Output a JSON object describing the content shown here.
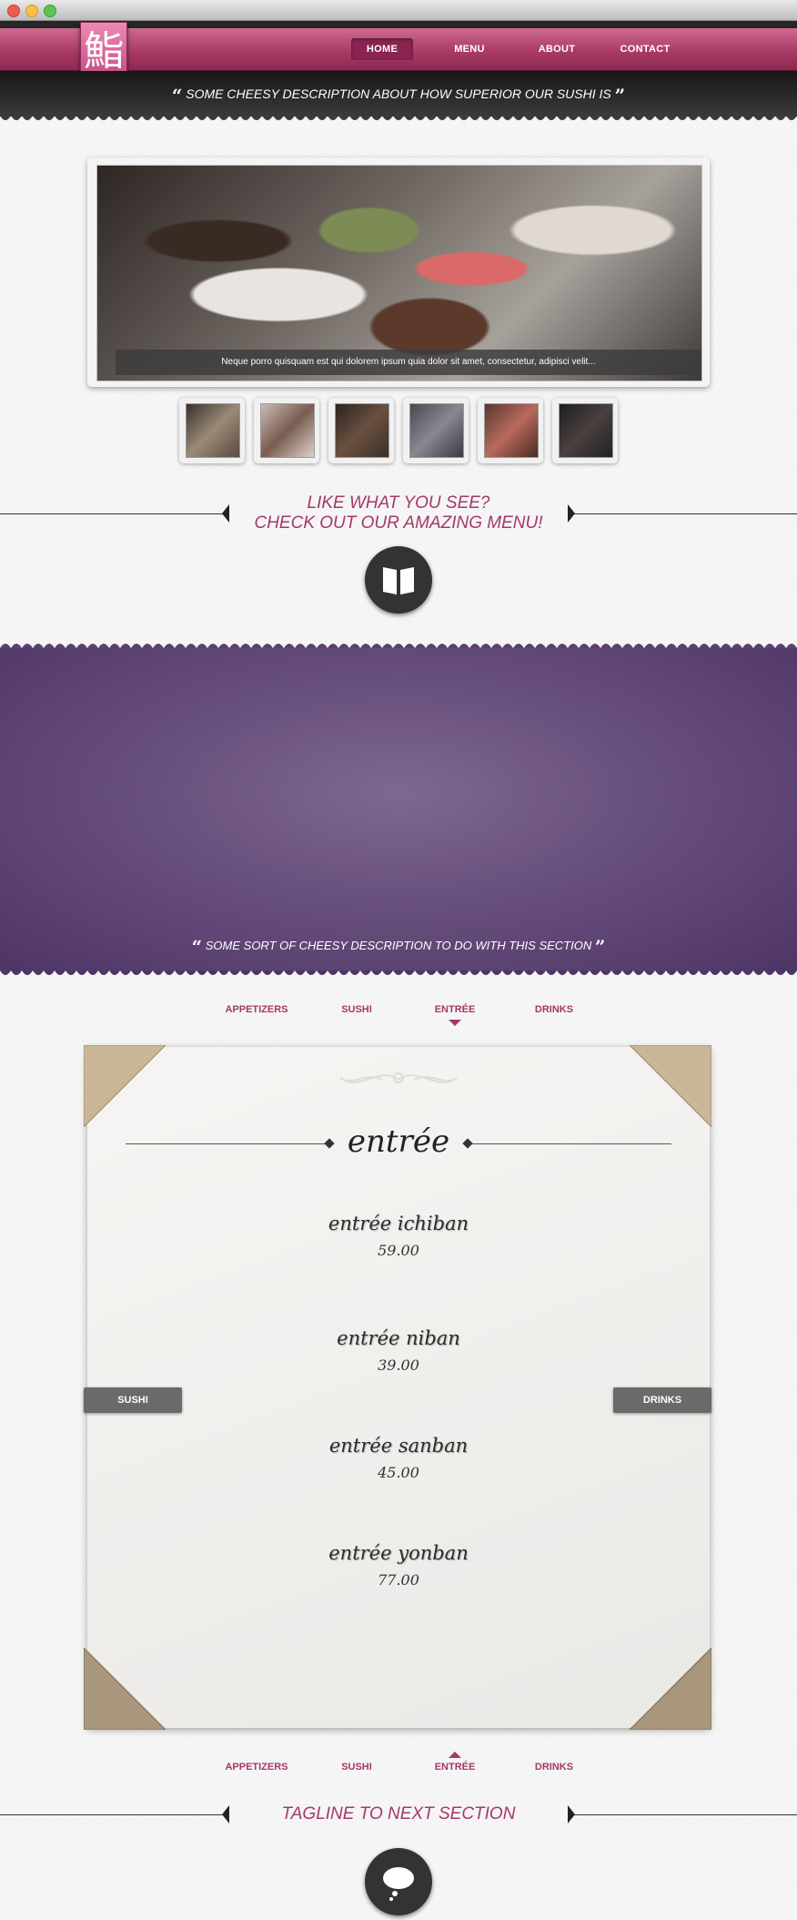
{
  "header": {
    "logo_glyph": "鮨",
    "nav": [
      "HOME",
      "MENU",
      "ABOUT",
      "CONTACT"
    ],
    "tagline": "SOME CHEESY DESCRIPTION ABOUT HOW SUPERIOR OUR SUSHI IS"
  },
  "slider": {
    "caption": "Neque porro quisquam est qui dolorem ipsum quia dolor sit amet, consectetur, adipisci velit..."
  },
  "cta": {
    "line1": "LIKE WHAT YOU SEE?",
    "line2": "CHECK OUT OUR AMAZING MENU!"
  },
  "section": {
    "description": "SOME SORT OF CHEESY DESCRIPTION TO DO WITH THIS SECTION"
  },
  "menu": {
    "tabs": [
      "APPETIZERS",
      "SUSHI",
      "ENTRÉE",
      "DRINKS"
    ],
    "active_tab": "ENTRÉE",
    "title": "entrée",
    "items": [
      {
        "name": "entrée ichiban",
        "price": "59.00"
      },
      {
        "name": "entrée niban",
        "price": "39.00"
      },
      {
        "name": "entrée sanban",
        "price": "45.00"
      },
      {
        "name": "entrée yonban",
        "price": "77.00"
      }
    ],
    "prev_label": "SUSHI",
    "next_label": "DRINKS"
  },
  "footer": {
    "tagline": "TAGLINE TO NEXT SECTION"
  },
  "colors": {
    "brand_pink": "#a4386a",
    "purple_band": "#6a527e",
    "dark": "#333333"
  },
  "icons": [
    "quote-open-icon",
    "quote-close-icon",
    "book-icon",
    "speech-bubble-icon"
  ]
}
